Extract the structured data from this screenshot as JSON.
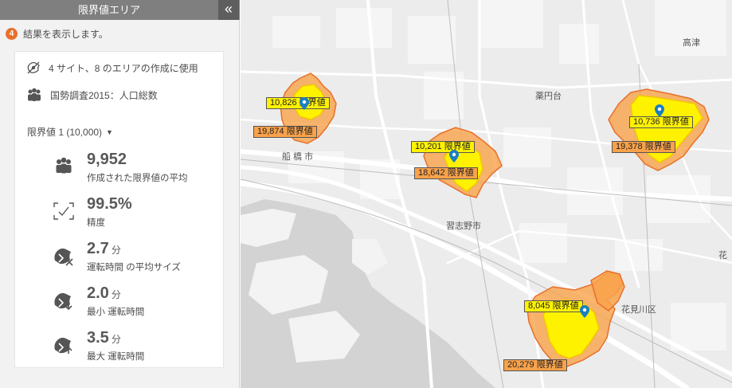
{
  "panel": {
    "title": "限界値エリア",
    "collapse_icon": "double-chevron-left-icon",
    "step": {
      "number": "4",
      "text": "結果を表示します。"
    },
    "info": {
      "sites_text": "4 サイト、8 のエリアの作成に使用",
      "dataset_text": "国勢調査2015：人口総数"
    },
    "threshold_select": {
      "label": "限界値 1 (10,000)"
    },
    "stats": [
      {
        "value": "9,952",
        "unit": "",
        "label": "作成された限界値の平均",
        "icon": "people-icon"
      },
      {
        "value": "99.5%",
        "unit": "",
        "label": "精度",
        "icon": "accuracy-check-icon"
      },
      {
        "value": "2.7",
        "unit": "分",
        "label": "運転時間 の平均サイズ",
        "icon": "drive-time-average-icon"
      },
      {
        "value": "2.0",
        "unit": "分",
        "label": "最小 運転時間",
        "icon": "drive-time-min-icon"
      },
      {
        "value": "3.5",
        "unit": "分",
        "label": "最大 運転時間",
        "icon": "drive-time-max-icon"
      }
    ]
  },
  "map": {
    "place_labels": {
      "funabashi": "船 橋 市",
      "narashino": "習志野市",
      "yakuendai": "薬円台",
      "takatsu": "高津",
      "hanamigawa": "花見川区",
      "hana": "花"
    },
    "areas": [
      {
        "inner_label": "10,826 限界値",
        "outer_label": "19,874 限界値"
      },
      {
        "inner_label": "10,201 限界値",
        "outer_label": "18,642 限界値"
      },
      {
        "inner_label": "10,736 限界値",
        "outer_label": "19,378 限界値"
      },
      {
        "inner_label": "8,045 限界値",
        "outer_label": "20,279 限界値"
      }
    ],
    "colors": {
      "inner_fill": "#fff200",
      "outer_fill": "#f9a24a",
      "pin": "#1a7fc1",
      "step_badge": "#e8702a"
    }
  }
}
